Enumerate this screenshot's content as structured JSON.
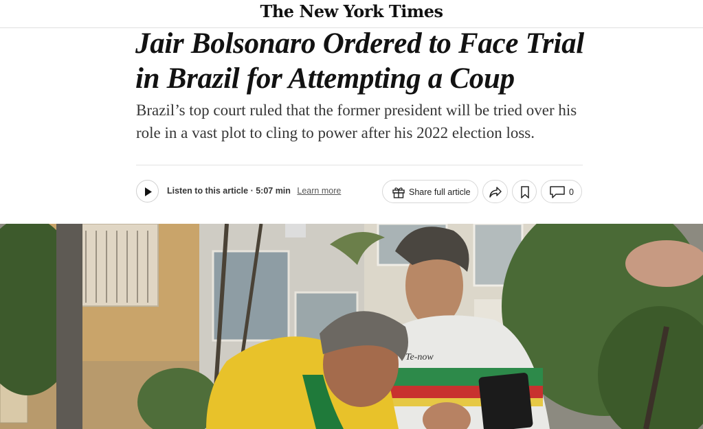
{
  "masthead": {
    "logo_text": "The New York Times"
  },
  "article": {
    "headline": "Jair Bolsonaro Ordered to Face Trial in Brazil for Attempting a Coup",
    "summary": "Brazil’s top court ruled that the former president will be tried over his role in a vast plot to cling to power after his 2022 election loss."
  },
  "toolbar": {
    "listen_label": "Listen to this article",
    "separator": " · ",
    "duration": "5:07 min",
    "learn_more": "Learn more",
    "share_label": "Share full article",
    "comment_count": "0"
  },
  "photo": {
    "shirt_text": "Te-now"
  },
  "icons": {
    "play": "play-icon",
    "gift": "gift-icon",
    "share": "share-arrow-icon",
    "bookmark": "bookmark-icon",
    "comment": "comment-icon"
  }
}
